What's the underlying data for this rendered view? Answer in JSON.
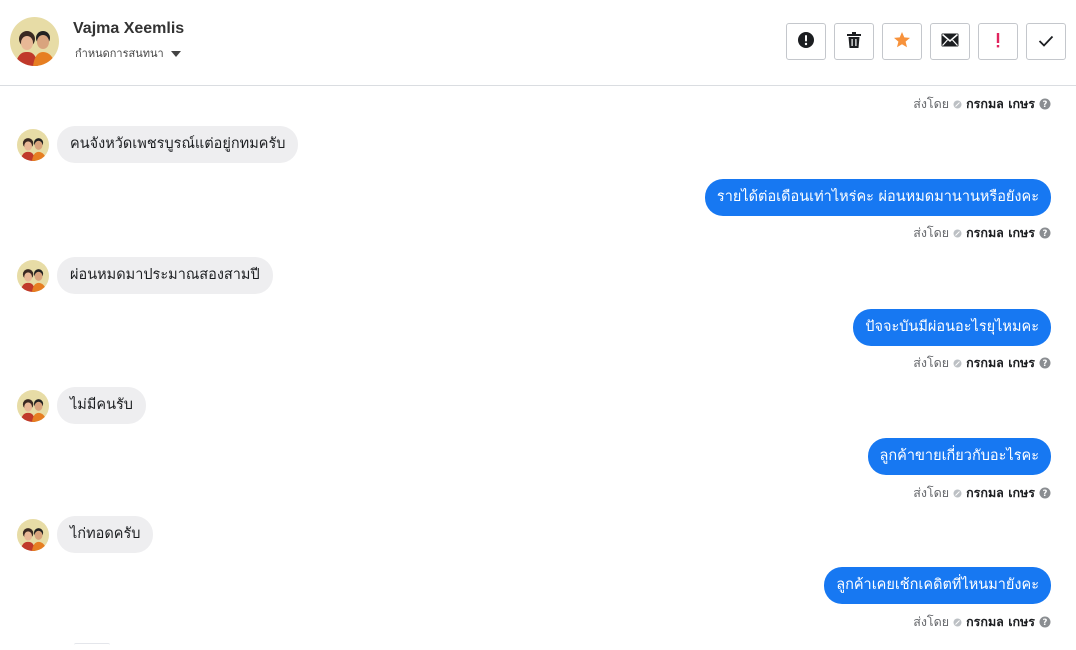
{
  "header": {
    "contact_name": "Vajma Xeemlis",
    "status": "กำหนดการสนทนา",
    "actions": [
      {
        "name": "report-button",
        "icon": "exclamation-circle-icon"
      },
      {
        "name": "delete-button",
        "icon": "trash-icon"
      },
      {
        "name": "star-button",
        "icon": "star-icon"
      },
      {
        "name": "mark-unread-button",
        "icon": "envelope-icon"
      },
      {
        "name": "important-button",
        "icon": "exclamation-mark-icon"
      },
      {
        "name": "done-button",
        "icon": "check-icon"
      }
    ]
  },
  "thread": {
    "sent_label": "ส่งโดย",
    "sender_name": "กรกมล เกษร",
    "messages": [
      {
        "from": "contact",
        "text": "คนจังหวัดเพชรบูรณ์แต่อยู่กทมครับ"
      },
      {
        "from": "page",
        "text": "รายได้ต่อเดือนเท่าไหร่คะ ผ่อนหมดมานานหรือยังคะ"
      },
      {
        "from": "contact",
        "text": "ผ่อนหมดมาประมาณสองสามปี"
      },
      {
        "from": "page",
        "text": "ปัจจะบันมีผ่อนอะไรยุไหมคะ"
      },
      {
        "from": "contact",
        "text": "ไม่มีคนรับ"
      },
      {
        "from": "page",
        "text": "ลูกค้าขายเกี่ยวกับอะไรคะ"
      },
      {
        "from": "contact",
        "text": "ไก่ทอดครับ"
      },
      {
        "from": "page",
        "text": "ลูกค้าเคยเช้กเคดิตที่ไหนมายังคะ"
      }
    ]
  },
  "colors": {
    "outgoing_bubble": "#1778f2",
    "incoming_bubble": "#eeeef0",
    "star": "#f7923b",
    "important": "#e0245e"
  }
}
